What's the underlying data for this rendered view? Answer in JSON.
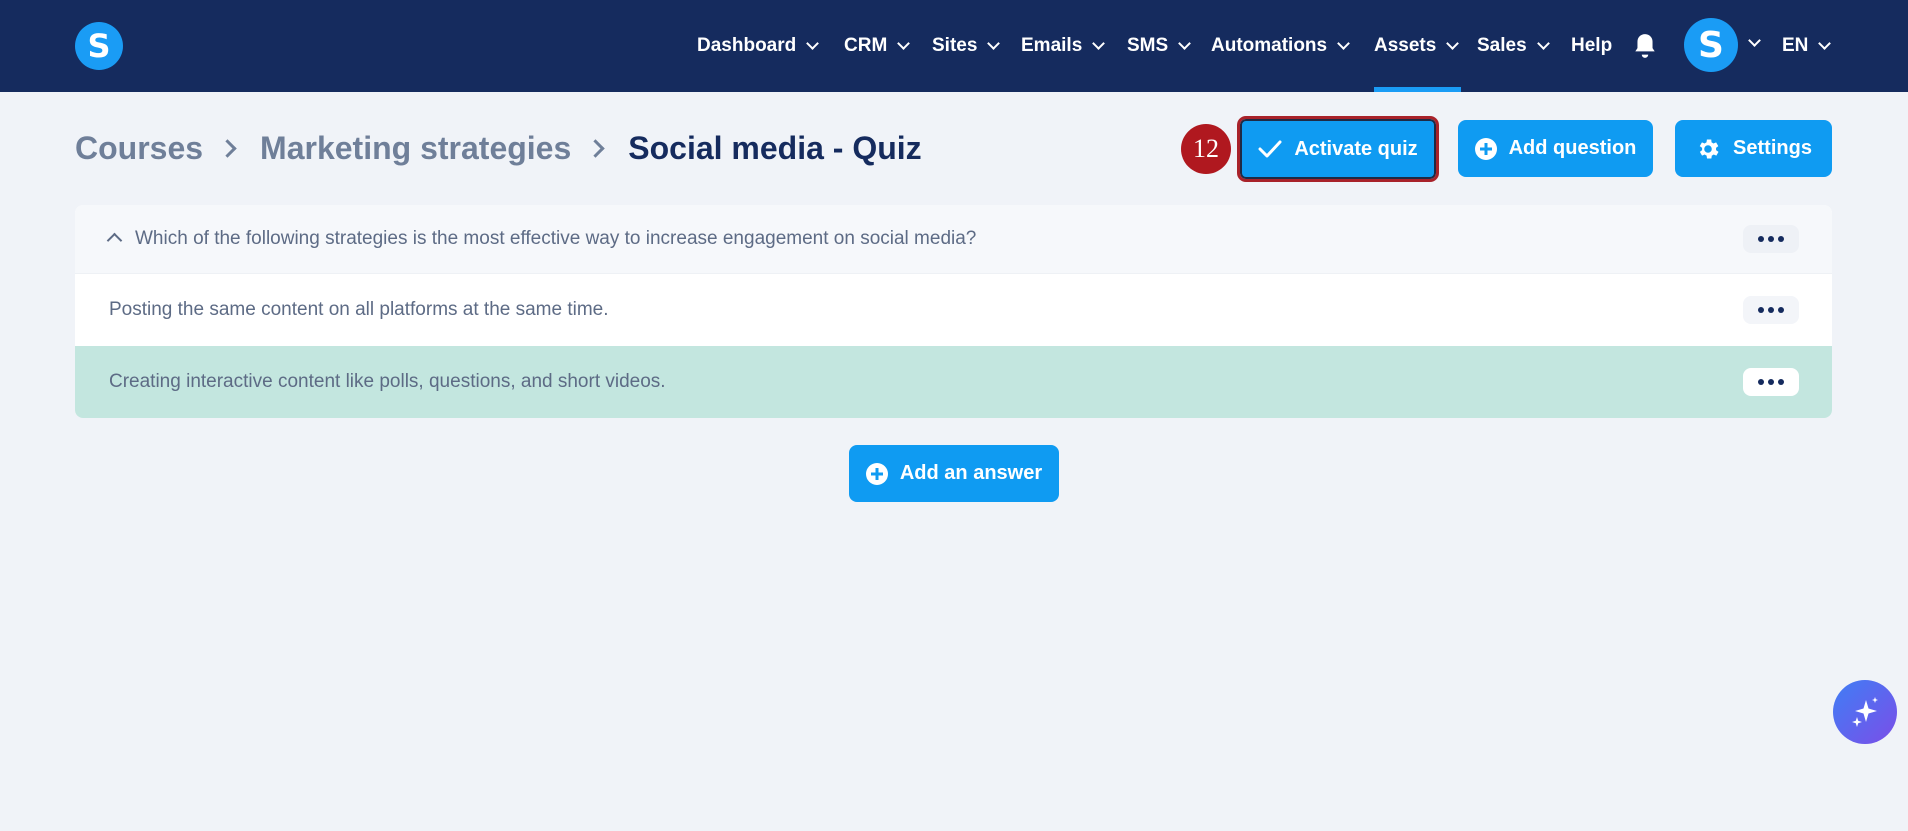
{
  "app": {
    "logo_letter": "S",
    "nav": [
      {
        "label": "Dashboard",
        "has_dropdown": true
      },
      {
        "label": "CRM",
        "has_dropdown": true
      },
      {
        "label": "Sites",
        "has_dropdown": true
      },
      {
        "label": "Emails",
        "has_dropdown": true
      },
      {
        "label": "SMS",
        "has_dropdown": true
      },
      {
        "label": "Automations",
        "has_dropdown": true
      },
      {
        "label": "Assets",
        "has_dropdown": true,
        "active": true
      },
      {
        "label": "Sales",
        "has_dropdown": true
      },
      {
        "label": "Help",
        "has_dropdown": false
      }
    ],
    "avatar_letter": "S",
    "language": "EN",
    "colors": {
      "topbar": "#152b5e",
      "accent": "#0f9bf2",
      "correct_answer": "#c3e6df",
      "step_badge": "#b0181f"
    }
  },
  "breadcrumb": {
    "items": [
      "Courses",
      "Marketing strategies"
    ],
    "current": "Social media - Quiz"
  },
  "step_badge": "12",
  "actions": {
    "activate_label": "Activate quiz",
    "add_question_label": "Add question",
    "settings_label": "Settings"
  },
  "quiz": {
    "question": "Which of the following strategies is the most effective way to increase engagement on social media?",
    "answers": [
      {
        "text": "Posting the same content on all platforms at the same time.",
        "correct": false
      },
      {
        "text": "Creating interactive content like polls, questions, and short videos.",
        "correct": true
      }
    ],
    "add_answer_label": "Add an answer"
  },
  "icons": {
    "bell": "bell-icon",
    "check": "check-icon",
    "plus": "plus-circle-icon",
    "gear": "gear-icon",
    "more": "more-horizontal-icon",
    "ai": "sparkles-icon"
  }
}
